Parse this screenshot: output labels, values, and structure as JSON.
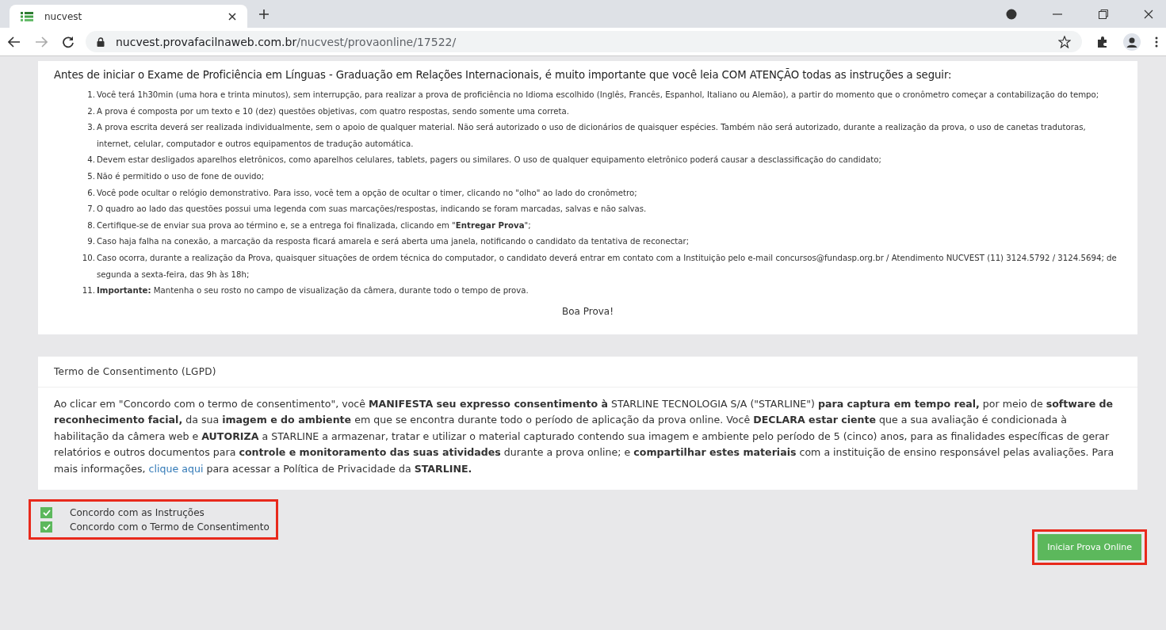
{
  "browser": {
    "tab_title": "nucvest",
    "url_host": "nucvest.provafacilnaweb.com.br",
    "url_path": "/nucvest/provaonline/17522/"
  },
  "instructions": {
    "heading": "Antes de iniciar o Exame de Proficiência em Línguas - Graduação em Relações Internacionais, é muito importante que você leia COM ATENÇÃO todas as instruções a seguir:",
    "items": [
      {
        "number": "1.",
        "text": "Você terá 1h30min (uma hora e trinta minutos), sem interrupção, para realizar a prova de proficiência no Idioma escolhido (Inglês, Francês, Espanhol, Italiano ou Alemão), a partir do momento que o cronômetro começar a contabilização do tempo;"
      },
      {
        "number": "2.",
        "text": "A prova é composta por um texto e 10 (dez) questões objetivas, com quatro respostas, sendo somente uma correta."
      },
      {
        "number": "3.",
        "text": "A prova escrita deverá ser realizada individualmente, sem o apoio de qualquer material. Não será autorizado o uso de dicionários de quaisquer espécies. Também não será autorizado, durante a realização da prova, o uso de canetas tradutoras, internet, celular, computador e outros equipamentos de tradução automática."
      },
      {
        "number": "4.",
        "text": "Devem estar desligados aparelhos eletrônicos, como aparelhos celulares, tablets, pagers ou similares. O uso de qualquer equipamento eletrônico poderá causar a desclassificação do candidato;"
      },
      {
        "number": "5.",
        "text": "Não é permitido o uso de fone de ouvido;"
      },
      {
        "number": "6.",
        "text": "Você pode ocultar o relógio demonstrativo. Para isso, você tem a opção de ocultar o timer, clicando no \"olho\" ao lado do cronômetro;"
      },
      {
        "number": "7.",
        "text": "O quadro ao lado das questões possui uma legenda com suas marcações/respostas, indicando se foram marcadas, salvas e não salvas."
      },
      {
        "number": "8.",
        "text": "Certifique-se de enviar sua prova ao término e, se a entrega foi finalizada, clicando em \"**Entregar Prova**\";"
      },
      {
        "number": "9.",
        "text": "Caso haja falha na conexão, a marcação da resposta ficará amarela e será aberta uma janela, notificando o candidato da tentativa de reconectar;"
      },
      {
        "number": "10.",
        "text": "Caso ocorra, durante a realização da Prova, quaisquer situações de ordem técnica do computador, o candidato deverá entrar em contato com a Instituição pelo e-mail concursos@fundasp.org.br / Atendimento NUCVEST (11) 3124.5792 / 3124.5694; de segunda a sexta-feira, das 9h às 18h;"
      },
      {
        "number": "11.",
        "text": "**Importante:** Mantenha o seu rosto no campo de visualização da câmera, durante todo o tempo de prova."
      }
    ],
    "closing": "Boa Prova!"
  },
  "consent": {
    "title": "Termo de Consentimento (LGPD)",
    "text_before": "Ao clicar em \"Concordo com o termo de consentimento\", você **MANIFESTA seu expresso consentimento à** STARLINE TECNOLOGIA S/A (\"STARLINE\") **para captura em tempo real,** por meio de **software de reconhecimento facial,** da sua **imagem e do ambiente** em que se encontra durante todo o período de aplicação da prova online. Você **DECLARA estar ciente** que a sua avaliação é condicionada à habilitação da câmera web e **AUTORIZA** a STARLINE a armazenar, tratar e utilizar o material capturado contendo sua imagem e ambiente pelo período de 5 (cinco) anos, para as finalidades específicas de gerar relatórios e outros documentos para **controle e monitoramento das suas atividades** durante a prova online; e **compartilhar estes materiais** com a instituição de ensino responsável pelas avaliações. Para mais informações,",
    "link": "clique aqui",
    "text_after": "para acessar a Política de Privacidade da **STARLINE.**"
  },
  "agreements": {
    "highlighted": true,
    "items": [
      {
        "label": "Concordo com as Instruções",
        "checked": true
      },
      {
        "label": "Concordo com o Termo de Consentimento",
        "checked": true
      }
    ]
  },
  "start_button": {
    "label": "Iniciar Prova Online",
    "highlighted": true
  }
}
